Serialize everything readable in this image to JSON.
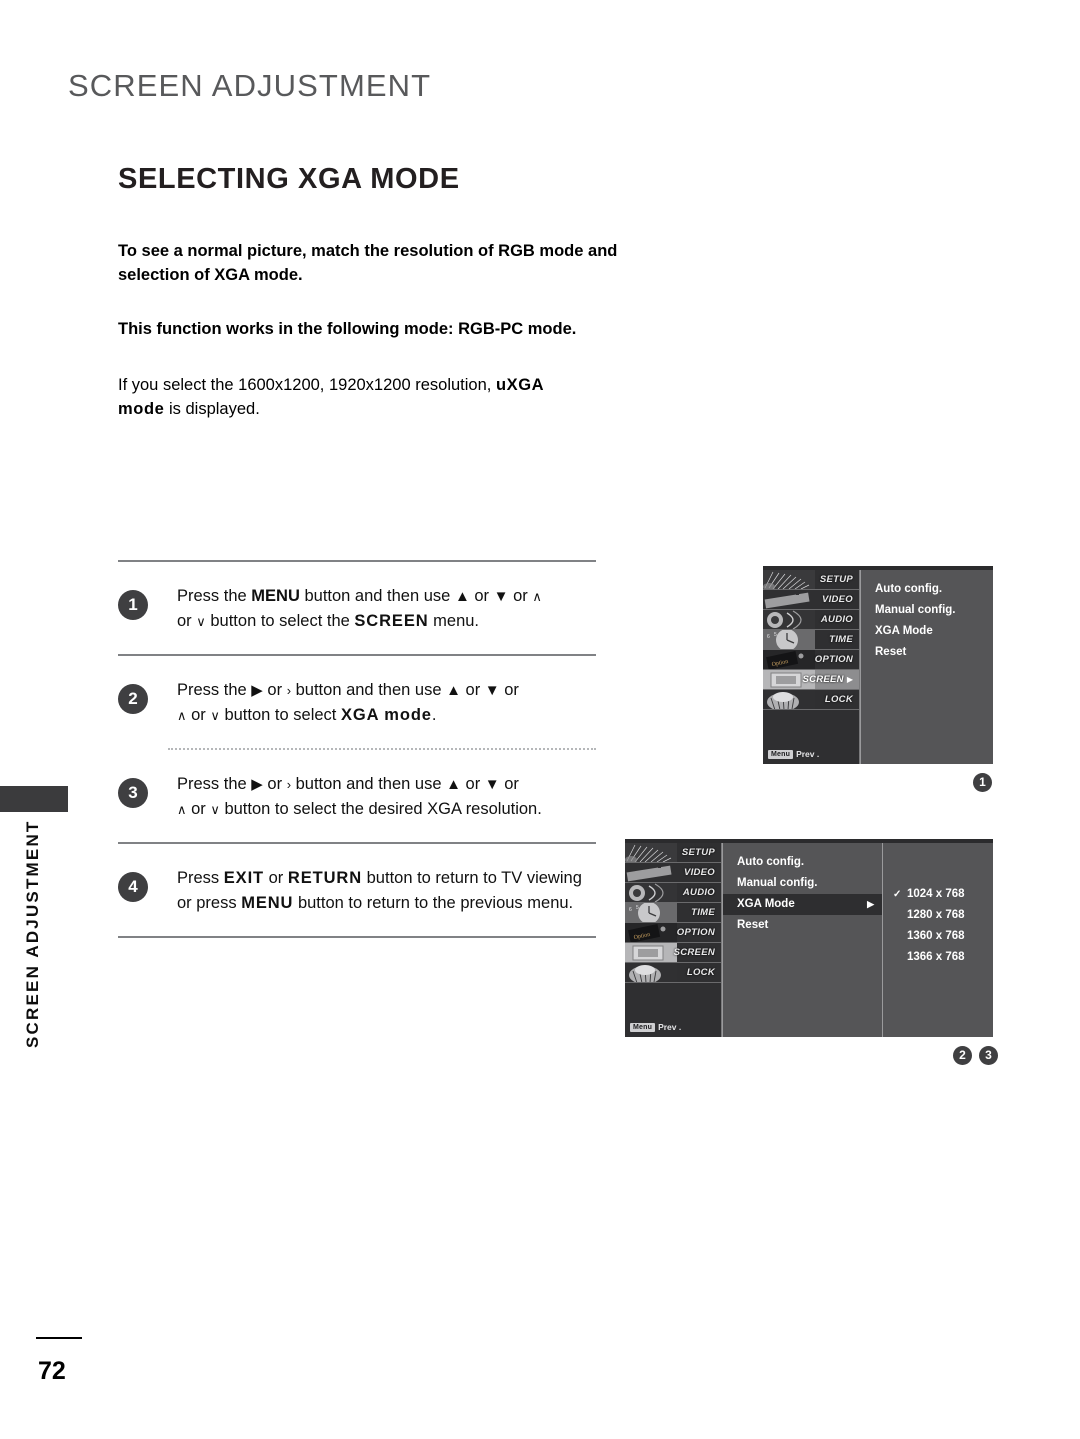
{
  "page": {
    "header_title": "SCREEN ADJUSTMENT",
    "section_title": "SELECTING XGA MODE",
    "side_tab": "SCREEN ADJUSTMENT",
    "page_number": "72"
  },
  "intro": {
    "paragraph_1": "To see a normal picture, match the resolution of RGB mode and selection of XGA mode.",
    "paragraph_2": "This function works in the following mode: RGB-PC mode.",
    "paragraph_3_a": "If you select the 1600x1200, 1920x1200 resolution, ",
    "paragraph_3_bold_1": "uXGA",
    "paragraph_3_bold_2": "mode",
    "paragraph_3_b": " is displayed."
  },
  "steps": [
    {
      "number": "1",
      "t1": "Press the ",
      "b1": "MENU",
      "t2": " button and then use ",
      "g1": "▲",
      "t3": " or ",
      "g2": "▼",
      "t4": " or ",
      "g3": "∧",
      "t5": " or ",
      "g4": "∨",
      "t6": " button to select the ",
      "b2": "SCREEN",
      "t7": " menu."
    },
    {
      "number": "2",
      "t1": "Press the ",
      "g0": "▶",
      "t1b": " or ",
      "g0b": "›",
      "t2": " button and then use ",
      "g1": "▲",
      "t3": " or ",
      "g2": "▼",
      "t4": " or ",
      "g3": "∧",
      "t5": " or ",
      "g4": "∨",
      "t6": " button to select ",
      "b2": "XGA mode",
      "t7": "."
    },
    {
      "number": "3",
      "t1": "Press the ",
      "g0": "▶",
      "t1b": " or ",
      "g0b": "›",
      "t2": " button and then use ",
      "g1": "▲",
      "t3": " or ",
      "g2": "▼",
      "t4": " or ",
      "g3": "∧",
      "t5": " or ",
      "g4": "∨",
      "t6": " button to select the desired XGA resolution.",
      "b2": "",
      "t7": ""
    },
    {
      "number": "4",
      "t1": "Press ",
      "b1": "EXIT",
      "t2": " or ",
      "b1b": "RETURN",
      "t3": " button to return to TV viewing or press ",
      "b2": "MENU",
      "t4": " button to return to the previous menu."
    }
  ],
  "osd": {
    "sidebar_items": [
      {
        "label": "SETUP",
        "selected": false
      },
      {
        "label": "VIDEO",
        "selected": false
      },
      {
        "label": "AUDIO",
        "selected": false
      },
      {
        "label": "TIME",
        "selected": false
      },
      {
        "label": "OPTION",
        "selected": false
      },
      {
        "label": "SCREEN",
        "selected": true
      },
      {
        "label": "LOCK",
        "selected": false
      }
    ],
    "prev_badge": "Menu",
    "prev_label": "Prev .",
    "menu_items": [
      "Auto config.",
      "Manual config.",
      "XGA Mode",
      "Reset"
    ],
    "submenu_arrow": "▶",
    "checkmark": "✓",
    "resolutions": [
      {
        "label": "1024 x 768",
        "checked": true
      },
      {
        "label": "1280 x 768",
        "checked": false
      },
      {
        "label": "1360 x 768",
        "checked": false
      },
      {
        "label": "1366 x 768",
        "checked": false
      }
    ]
  },
  "markers": {
    "group_1": [
      "1"
    ],
    "group_2": [
      "2",
      "3"
    ]
  }
}
